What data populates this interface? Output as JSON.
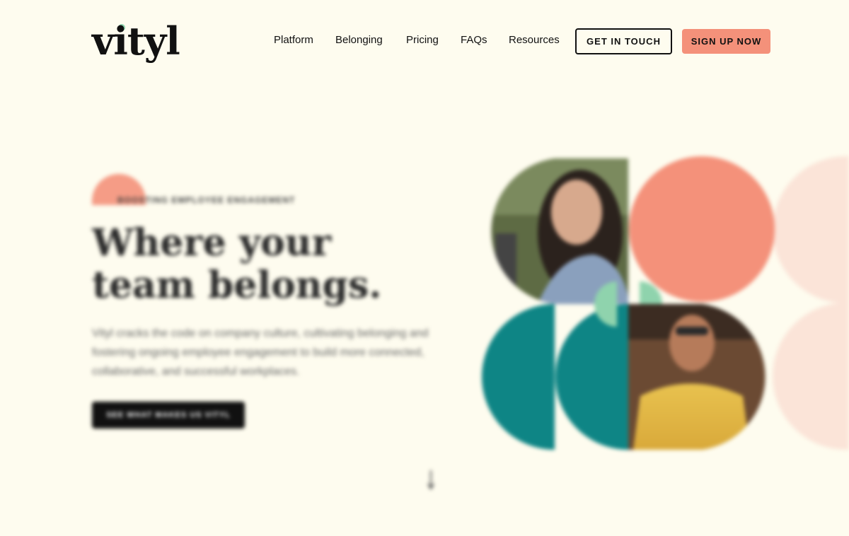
{
  "brand": {
    "name": "vityl",
    "dot_color": "#8fd3ad"
  },
  "nav": {
    "items": [
      {
        "label": "Platform"
      },
      {
        "label": "Belonging"
      },
      {
        "label": "Pricing"
      },
      {
        "label": "FAQs"
      },
      {
        "label": "Resources"
      }
    ],
    "get_in_touch": "GET IN TOUCH",
    "sign_up": "SIGN UP NOW"
  },
  "hero": {
    "eyebrow": "BOOSTING EMPLOYEE ENGAGEMENT",
    "headline": "Where your team belongs.",
    "subcopy": "Vityl cracks the code on company culture, cultivating belonging and fostering ongoing employee engagement to build more connected, collaborative, and successful workplaces.",
    "cta": "SEE WHAT MAKES US VITYL"
  },
  "colors": {
    "background": "#fefcef",
    "coral": "#f4917a",
    "teal": "#0e8585",
    "mint": "#8fd3ad",
    "pale_peach": "#fbe4d8",
    "ink": "#111111"
  }
}
